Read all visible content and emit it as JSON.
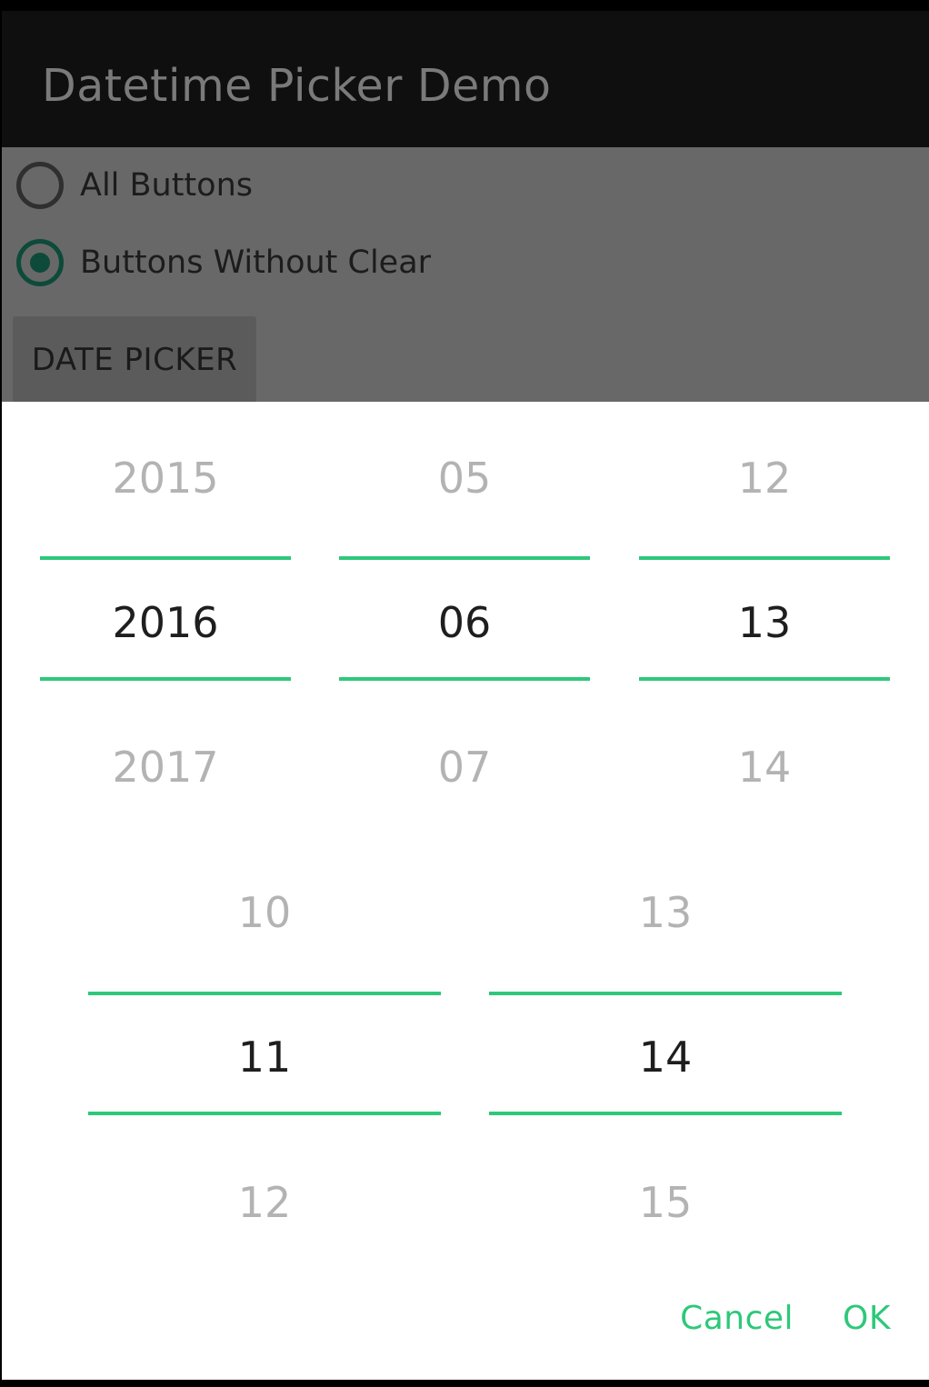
{
  "app": {
    "title": "Datetime Picker Demo"
  },
  "options": [
    {
      "label": "All Buttons",
      "checked": false
    },
    {
      "label": "Buttons Without Clear",
      "checked": true
    }
  ],
  "date_picker_button": "DATE PICKER",
  "picker": {
    "year": {
      "above": "2015",
      "selected": "2016",
      "below": "2017"
    },
    "month": {
      "above": "05",
      "selected": "06",
      "below": "07"
    },
    "day": {
      "above": "12",
      "selected": "13",
      "below": "14"
    },
    "hour": {
      "above": "10",
      "selected": "11",
      "below": "12"
    },
    "minute": {
      "above": "13",
      "selected": "14",
      "below": "15"
    }
  },
  "actions": {
    "cancel": "Cancel",
    "ok": "OK"
  },
  "colors": {
    "accent": "#2ec87a",
    "radio_checked": "#0d4a3a"
  }
}
